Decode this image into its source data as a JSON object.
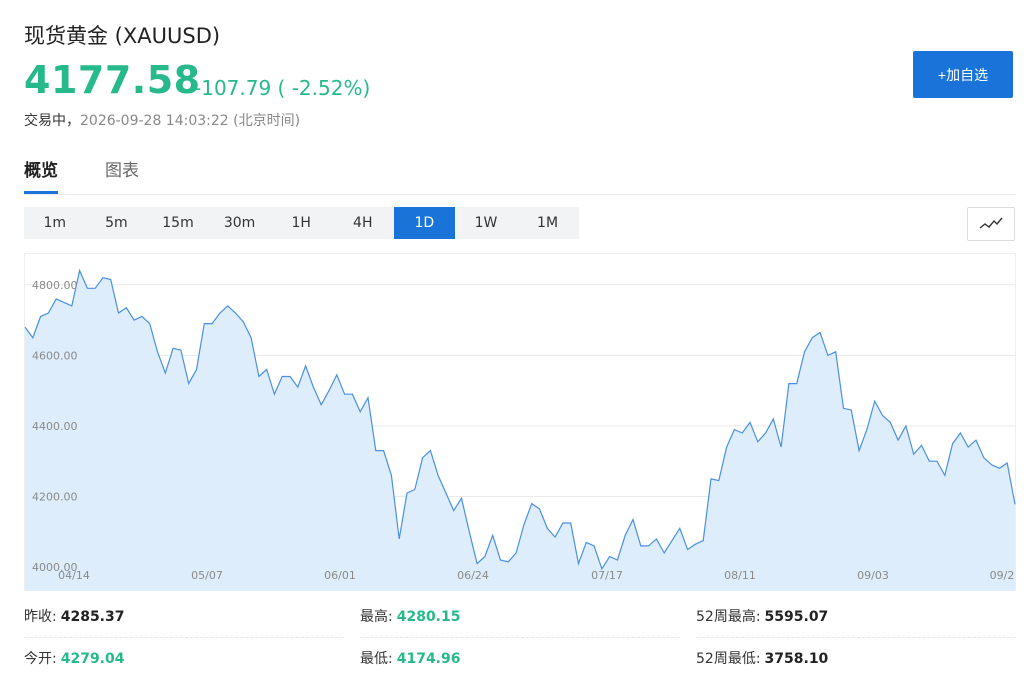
{
  "header": {
    "title": "现货黄金 (XAUUSD)",
    "price": "4177.58",
    "change": "-107.79 ( -2.52%)",
    "status_label": "交易中，",
    "timestamp": "2026-09-28 14:03:22 (北京时间)",
    "add_watchlist_label": "+加自选",
    "accent_color": "#1a73d9",
    "price_color": "#25b98b"
  },
  "tabs": [
    {
      "label": "概览",
      "active": true
    },
    {
      "label": "图表",
      "active": false
    }
  ],
  "intervals": [
    {
      "label": "1m",
      "active": false
    },
    {
      "label": "5m",
      "active": false
    },
    {
      "label": "15m",
      "active": false
    },
    {
      "label": "30m",
      "active": false
    },
    {
      "label": "1H",
      "active": false
    },
    {
      "label": "4H",
      "active": false
    },
    {
      "label": "1D",
      "active": true
    },
    {
      "label": "1W",
      "active": false
    },
    {
      "label": "1M",
      "active": false
    }
  ],
  "chart_type_icon": "line-chart-icon",
  "chart_data": {
    "type": "area",
    "x_ticks": [
      "04/14",
      "05/07",
      "06/01",
      "06/24",
      "07/17",
      "08/11",
      "09/03",
      "09/2"
    ],
    "y_ticks": [
      "4000.00",
      "4200.00",
      "4400.00",
      "4600.00",
      "4800.00"
    ],
    "ylim": [
      3955,
      4890
    ],
    "line_color": "#4a90e2",
    "fill_color": "#deedfb",
    "grid": true,
    "series": [
      {
        "values": [
          4680,
          4650,
          4710,
          4720,
          4760,
          4750,
          4740,
          4840,
          4790,
          4790,
          4820,
          4815,
          4720,
          4735,
          4700,
          4710,
          4690,
          4610,
          4550,
          4620,
          4615,
          4520,
          4560,
          4690,
          4690,
          4720,
          4740,
          4720,
          4695,
          4650,
          4540,
          4560,
          4490,
          4540,
          4540,
          4510,
          4570,
          4510,
          4460,
          4500,
          4545,
          4490,
          4490,
          4440,
          4480,
          4330,
          4330,
          4260,
          4080,
          4210,
          4220,
          4310,
          4330,
          4260,
          4210,
          4160,
          4195,
          4100,
          4010,
          4030,
          4090,
          4020,
          4015,
          4040,
          4120,
          4180,
          4165,
          4110,
          4085,
          4125,
          4125,
          4010,
          4070,
          4060,
          3995,
          4030,
          4020,
          4090,
          4135,
          4060,
          4060,
          4080,
          4040,
          4075,
          4110,
          4050,
          4065,
          4075,
          4250,
          4245,
          4340,
          4390,
          4380,
          4410,
          4355,
          4380,
          4420,
          4340,
          4520,
          4520,
          4610,
          4650,
          4665,
          4600,
          4610,
          4450,
          4445,
          4330,
          4390,
          4470,
          4430,
          4410,
          4360,
          4400,
          4320,
          4345,
          4300,
          4300,
          4260,
          4350,
          4380,
          4340,
          4360,
          4310,
          4290,
          4280,
          4295,
          4178
        ]
      }
    ]
  },
  "stats": {
    "prev_close": {
      "label": "昨收:",
      "value": "4285.37"
    },
    "high": {
      "label": "最高:",
      "value": "4280.15"
    },
    "high_52w": {
      "label": "52周最高:",
      "value": "5595.07"
    },
    "open": {
      "label": "今开:",
      "value": "4279.04"
    },
    "low": {
      "label": "最低:",
      "value": "4174.96"
    },
    "low_52w": {
      "label": "52周最低:",
      "value": "3758.10"
    }
  }
}
